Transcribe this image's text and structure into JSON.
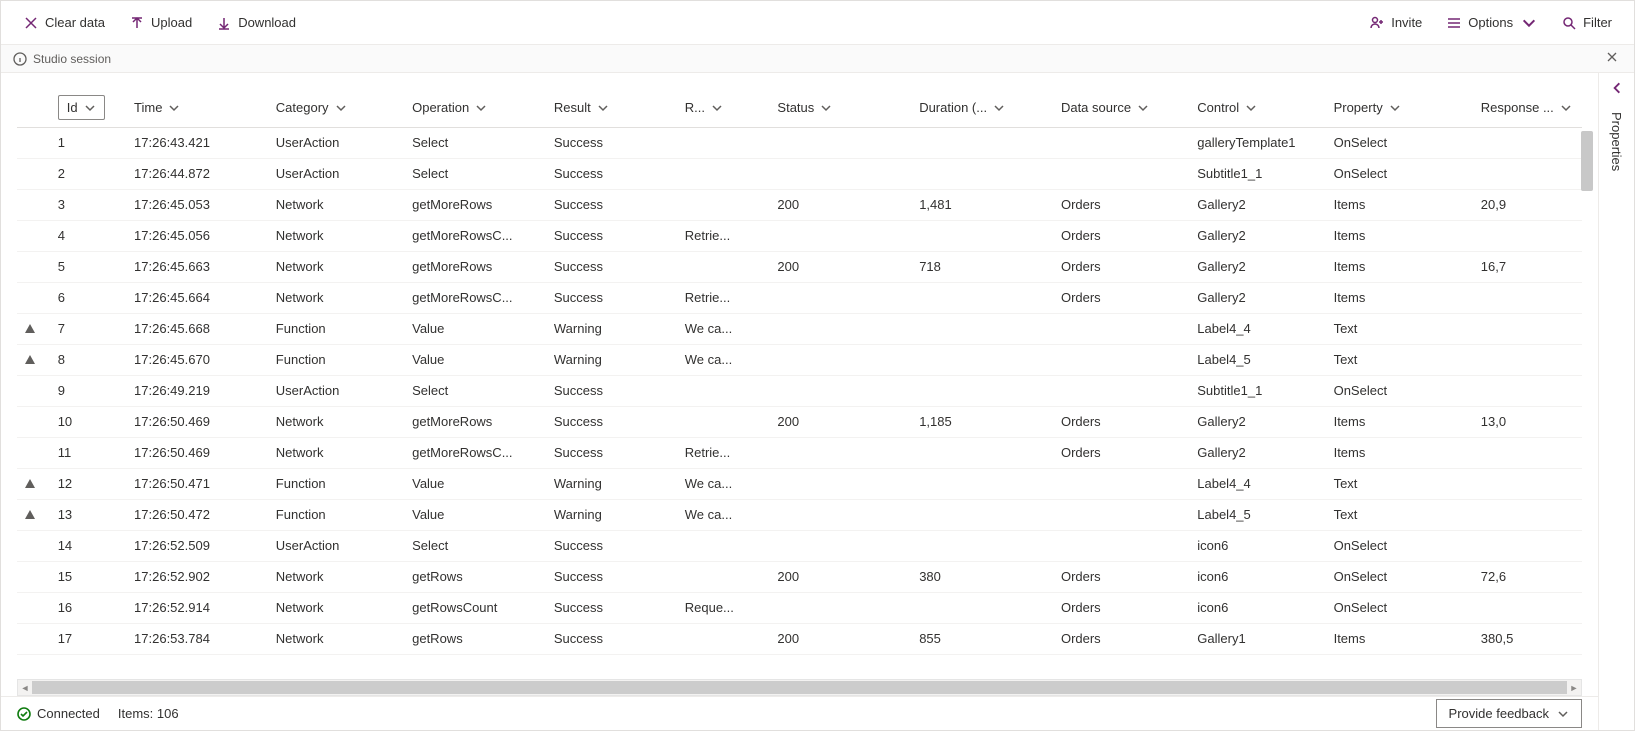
{
  "toolbar": {
    "clear_label": "Clear data",
    "upload_label": "Upload",
    "download_label": "Download",
    "invite_label": "Invite",
    "options_label": "Options",
    "filter_label": "Filter"
  },
  "session_bar": {
    "label": "Studio session"
  },
  "columns": {
    "id": "Id",
    "time": "Time",
    "category": "Category",
    "operation": "Operation",
    "result": "Result",
    "result_info": "R...",
    "status": "Status",
    "duration": "Duration (...",
    "data_source": "Data source",
    "control": "Control",
    "property": "Property",
    "response": "Response ..."
  },
  "rows": [
    {
      "warn": false,
      "id": "1",
      "time": "17:26:43.421",
      "category": "UserAction",
      "operation": "Select",
      "result": "Success",
      "rinfo": "",
      "status": "",
      "duration": "",
      "ds": "",
      "control": "galleryTemplate1",
      "property": "OnSelect",
      "response": ""
    },
    {
      "warn": false,
      "id": "2",
      "time": "17:26:44.872",
      "category": "UserAction",
      "operation": "Select",
      "result": "Success",
      "rinfo": "",
      "status": "",
      "duration": "",
      "ds": "",
      "control": "Subtitle1_1",
      "property": "OnSelect",
      "response": ""
    },
    {
      "warn": false,
      "id": "3",
      "time": "17:26:45.053",
      "category": "Network",
      "operation": "getMoreRows",
      "result": "Success",
      "rinfo": "",
      "status": "200",
      "duration": "1,481",
      "ds": "Orders",
      "control": "Gallery2",
      "property": "Items",
      "response": "20,9"
    },
    {
      "warn": false,
      "id": "4",
      "time": "17:26:45.056",
      "category": "Network",
      "operation": "getMoreRowsC...",
      "result": "Success",
      "rinfo": "Retrie...",
      "status": "",
      "duration": "",
      "ds": "Orders",
      "control": "Gallery2",
      "property": "Items",
      "response": ""
    },
    {
      "warn": false,
      "id": "5",
      "time": "17:26:45.663",
      "category": "Network",
      "operation": "getMoreRows",
      "result": "Success",
      "rinfo": "",
      "status": "200",
      "duration": "718",
      "ds": "Orders",
      "control": "Gallery2",
      "property": "Items",
      "response": "16,7"
    },
    {
      "warn": false,
      "id": "6",
      "time": "17:26:45.664",
      "category": "Network",
      "operation": "getMoreRowsC...",
      "result": "Success",
      "rinfo": "Retrie...",
      "status": "",
      "duration": "",
      "ds": "Orders",
      "control": "Gallery2",
      "property": "Items",
      "response": ""
    },
    {
      "warn": true,
      "id": "7",
      "time": "17:26:45.668",
      "category": "Function",
      "operation": "Value",
      "result": "Warning",
      "rinfo": "We ca...",
      "status": "",
      "duration": "",
      "ds": "",
      "control": "Label4_4",
      "property": "Text",
      "response": ""
    },
    {
      "warn": true,
      "id": "8",
      "time": "17:26:45.670",
      "category": "Function",
      "operation": "Value",
      "result": "Warning",
      "rinfo": "We ca...",
      "status": "",
      "duration": "",
      "ds": "",
      "control": "Label4_5",
      "property": "Text",
      "response": ""
    },
    {
      "warn": false,
      "id": "9",
      "time": "17:26:49.219",
      "category": "UserAction",
      "operation": "Select",
      "result": "Success",
      "rinfo": "",
      "status": "",
      "duration": "",
      "ds": "",
      "control": "Subtitle1_1",
      "property": "OnSelect",
      "response": ""
    },
    {
      "warn": false,
      "id": "10",
      "time": "17:26:50.469",
      "category": "Network",
      "operation": "getMoreRows",
      "result": "Success",
      "rinfo": "",
      "status": "200",
      "duration": "1,185",
      "ds": "Orders",
      "control": "Gallery2",
      "property": "Items",
      "response": "13,0"
    },
    {
      "warn": false,
      "id": "11",
      "time": "17:26:50.469",
      "category": "Network",
      "operation": "getMoreRowsC...",
      "result": "Success",
      "rinfo": "Retrie...",
      "status": "",
      "duration": "",
      "ds": "Orders",
      "control": "Gallery2",
      "property": "Items",
      "response": ""
    },
    {
      "warn": true,
      "id": "12",
      "time": "17:26:50.471",
      "category": "Function",
      "operation": "Value",
      "result": "Warning",
      "rinfo": "We ca...",
      "status": "",
      "duration": "",
      "ds": "",
      "control": "Label4_4",
      "property": "Text",
      "response": ""
    },
    {
      "warn": true,
      "id": "13",
      "time": "17:26:50.472",
      "category": "Function",
      "operation": "Value",
      "result": "Warning",
      "rinfo": "We ca...",
      "status": "",
      "duration": "",
      "ds": "",
      "control": "Label4_5",
      "property": "Text",
      "response": ""
    },
    {
      "warn": false,
      "id": "14",
      "time": "17:26:52.509",
      "category": "UserAction",
      "operation": "Select",
      "result": "Success",
      "rinfo": "",
      "status": "",
      "duration": "",
      "ds": "",
      "control": "icon6",
      "property": "OnSelect",
      "response": ""
    },
    {
      "warn": false,
      "id": "15",
      "time": "17:26:52.902",
      "category": "Network",
      "operation": "getRows",
      "result": "Success",
      "rinfo": "",
      "status": "200",
      "duration": "380",
      "ds": "Orders",
      "control": "icon6",
      "property": "OnSelect",
      "response": "72,6"
    },
    {
      "warn": false,
      "id": "16",
      "time": "17:26:52.914",
      "category": "Network",
      "operation": "getRowsCount",
      "result": "Success",
      "rinfo": "Reque...",
      "status": "",
      "duration": "",
      "ds": "Orders",
      "control": "icon6",
      "property": "OnSelect",
      "response": ""
    },
    {
      "warn": false,
      "id": "17",
      "time": "17:26:53.784",
      "category": "Network",
      "operation": "getRows",
      "result": "Success",
      "rinfo": "",
      "status": "200",
      "duration": "855",
      "ds": "Orders",
      "control": "Gallery1",
      "property": "Items",
      "response": "380,5"
    }
  ],
  "status_bar": {
    "connected_label": "Connected",
    "items_label": "Items: 106",
    "feedback_label": "Provide feedback"
  },
  "properties_panel": {
    "label": "Properties"
  }
}
